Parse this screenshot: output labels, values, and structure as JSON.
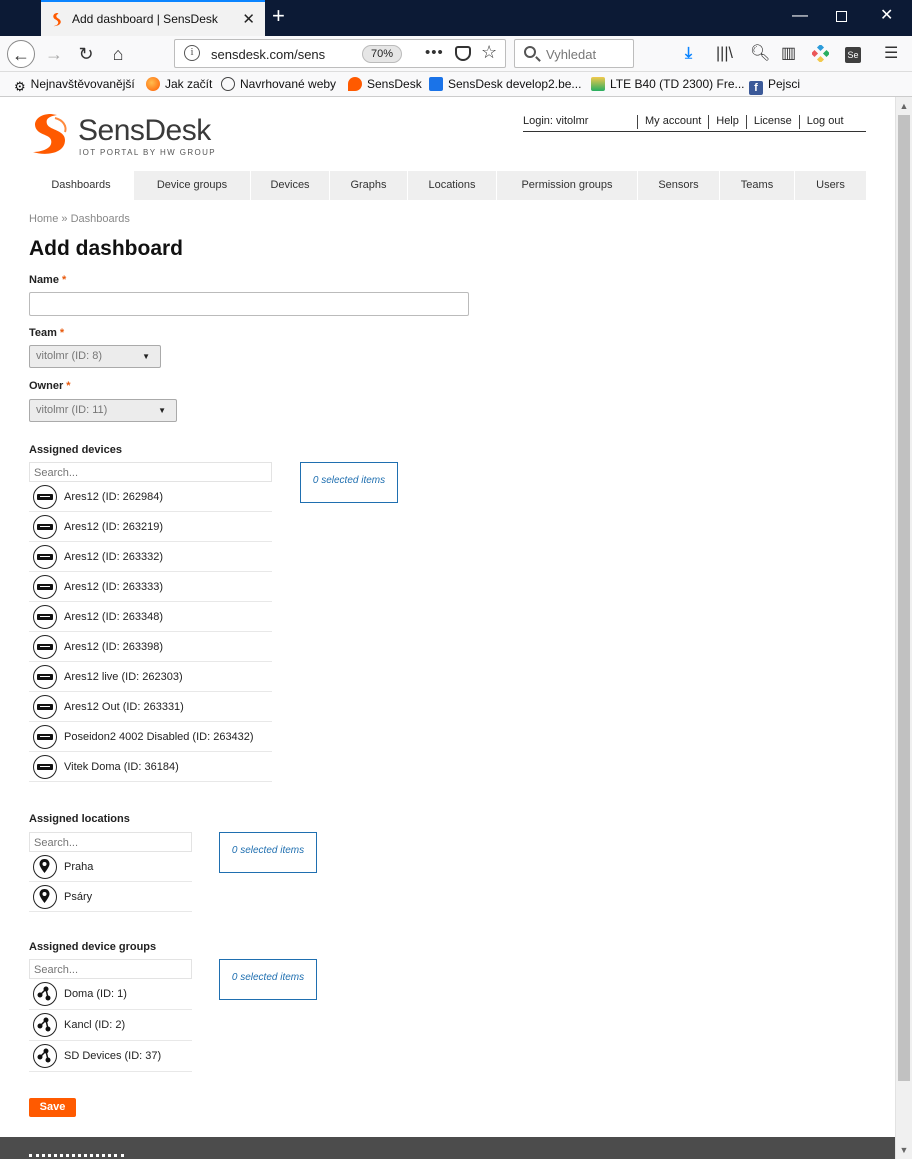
{
  "browser": {
    "tab_title": "Add dashboard | SensDesk",
    "url": "sensdesk.com/sens",
    "zoom": "70%",
    "search_placeholder": "Vyhledat",
    "bookmarks": [
      "Nejnavštěvovanější",
      "Jak začít",
      "Navrhované weby",
      "SensDesk",
      "SensDesk develop2.be...",
      "LTE B40 (TD 2300) Fre...",
      "Pejsci"
    ]
  },
  "header": {
    "logo_name": "SensDesk",
    "logo_tagline": "IOT PORTAL BY HW GROUP",
    "login": "Login: vitolmr",
    "my_account": "My account",
    "help": "Help",
    "license": "License",
    "logout": "Log out"
  },
  "nav": [
    "Dashboards",
    "Device groups",
    "Devices",
    "Graphs",
    "Locations",
    "Permission groups",
    "Sensors",
    "Teams",
    "Users"
  ],
  "breadcrumb": "Home » Dashboards",
  "page_title": "Add dashboard",
  "form": {
    "name_label": "Name",
    "name_value": "",
    "required_mark": "*",
    "team_label": "Team",
    "team_value": "vitolmr (ID: 8)",
    "owner_label": "Owner",
    "owner_value": "vitolmr (ID: 11)",
    "devices_label": "Assigned devices",
    "search_placeholder": "Search...",
    "devices": [
      "Ares12 (ID: 262984)",
      "Ares12 (ID: 263219)",
      "Ares12 (ID: 263332)",
      "Ares12 (ID: 263333)",
      "Ares12 (ID: 263348)",
      "Ares12 (ID: 263398)",
      "Ares12 live (ID: 262303)",
      "Ares12 Out (ID: 263331)",
      "Poseidon2 4002 Disabled (ID: 263432)",
      "Vitek Doma (ID: 36184)"
    ],
    "devices_selected": "0 selected items",
    "locations_label": "Assigned locations",
    "locations": [
      "Praha",
      "Psáry"
    ],
    "locations_selected": "0 selected items",
    "groups_label": "Assigned device groups",
    "groups": [
      "Doma (ID: 1)",
      "Kancl (ID: 2)",
      "SD Devices (ID: 37)"
    ],
    "groups_selected": "0 selected items",
    "save_label": "Save"
  },
  "colors": {
    "brand_orange": "#ff5a00",
    "selected_box_blue": "#1f6fb0"
  }
}
